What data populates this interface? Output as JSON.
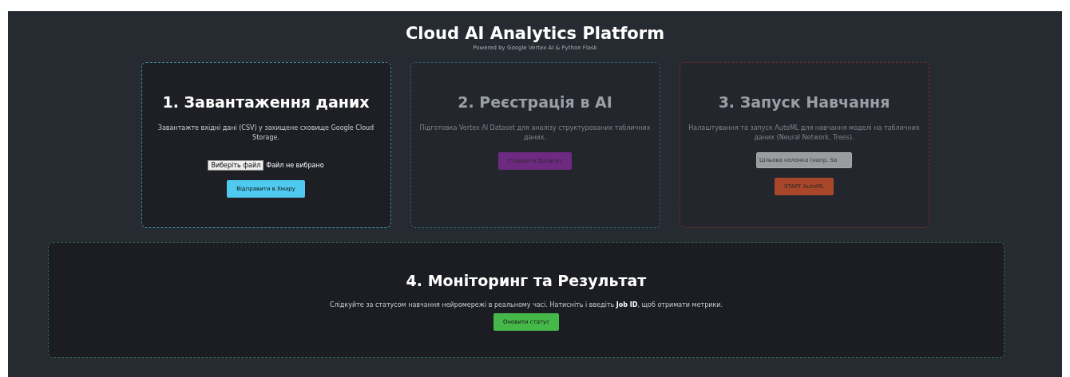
{
  "header": {
    "title": "Cloud AI Analytics Platform",
    "subtitle": "Powered by Google Vertex AI & Python Flask"
  },
  "steps": [
    {
      "title": "1. Завантаження даних",
      "description": "Завантажте вхідні дані (CSV) у захищене сховище Google Cloud Storage.",
      "color": "#3a8aa3",
      "disabled": false,
      "wide": false,
      "controls": [
        {
          "kind": "file",
          "button": "Виберіть файл",
          "status": "Файл не вибрано"
        },
        {
          "kind": "button",
          "label": "Відправити в Хмару",
          "color": "#4fc9ef"
        }
      ]
    },
    {
      "title": "2. Реєстрація в AI",
      "description": "Підготовка Vertex AI Dataset для аналізу структурованих табличних даних.",
      "color": "#2f5f6c",
      "disabled": true,
      "wide": false,
      "controls": [
        {
          "kind": "button",
          "label": "Створити Датасет",
          "color": "#6d2a80"
        }
      ]
    },
    {
      "title": "3. Запуск Навчання",
      "description": "Налаштування та запуск AutoML для навчання моделі на табличних даних (Neural Network, Trees).",
      "color": "#6a3228",
      "disabled": true,
      "wide": false,
      "controls": [
        {
          "kind": "input",
          "placeholder": "Цільова колонка (напр. Sa"
        },
        {
          "kind": "button",
          "label": "START AutoML",
          "color": "#a8462a"
        }
      ]
    },
    {
      "title": "4. Моніторинг та Результат",
      "description": "Слідкуйте за статусом навчання нейромережі в реальному часі. Натисніть і введіть **Job ID**, щоб отримати метрики.",
      "color": "#2f6a3c",
      "disabled": false,
      "wide": true,
      "controls": [
        {
          "kind": "button",
          "label": "Оновити статус",
          "color": "#46b84a"
        }
      ]
    }
  ]
}
